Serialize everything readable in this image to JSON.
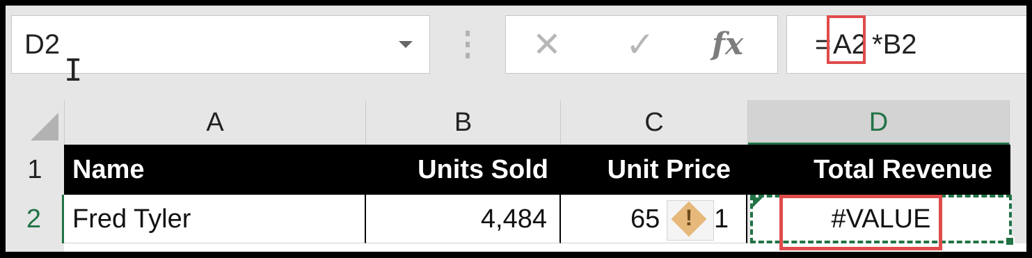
{
  "formula_bar": {
    "name_box_value": "D2",
    "cancel_icon": "✕",
    "enter_icon": "✓",
    "function_icon": "fx",
    "formula_equals": "=",
    "formula_ref": "A2",
    "formula_rest": "*B2"
  },
  "column_headers": [
    "A",
    "B",
    "C",
    "D"
  ],
  "row_headers": [
    "1",
    "2"
  ],
  "header_row": {
    "name": "Name",
    "units_sold": "Units Sold",
    "unit_price": "Unit Price",
    "total_revenue": "Total Revenue"
  },
  "data_row": {
    "name": "Fred Tyler",
    "units_sold": "4,484",
    "unit_price_left": "65",
    "unit_price_right": "1",
    "total_revenue": "#VALUE"
  },
  "error_indicator": {
    "icon": "warning-diamond-icon",
    "symbol": "!"
  },
  "colors": {
    "excel_green": "#217346",
    "highlight_red": "#e04b4b",
    "warning_amber": "#e6b87a"
  }
}
